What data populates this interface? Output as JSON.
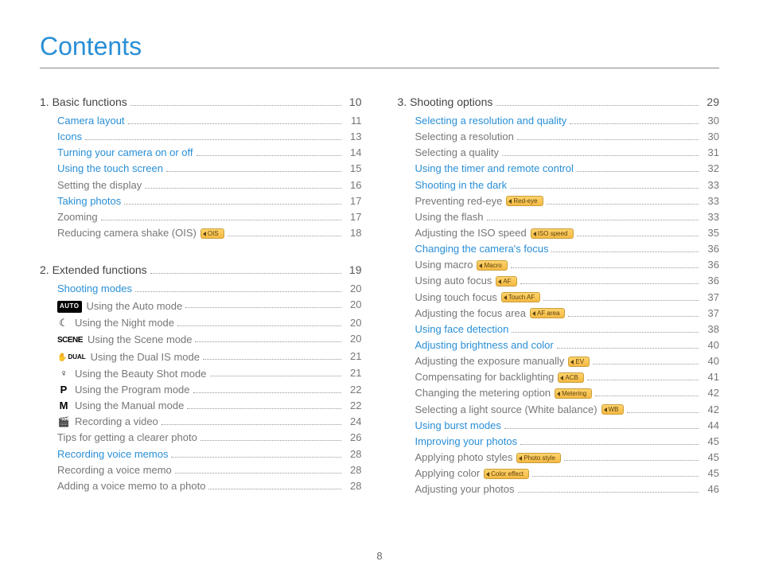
{
  "title": "Contents",
  "page_number": "8",
  "left": [
    {
      "type": "section",
      "label": "1. Basic functions",
      "page": "10"
    },
    {
      "type": "entry",
      "blue": true,
      "label": "Camera layout",
      "page": "11"
    },
    {
      "type": "entry",
      "blue": true,
      "label": "Icons",
      "page": "13"
    },
    {
      "type": "entry",
      "blue": true,
      "label": "Turning your camera on or off",
      "page": "14"
    },
    {
      "type": "entry",
      "blue": true,
      "label": "Using the touch screen",
      "page": "15"
    },
    {
      "type": "entry",
      "label": "Setting the display",
      "page": "16"
    },
    {
      "type": "entry",
      "blue": true,
      "label": "Taking photos",
      "page": "17"
    },
    {
      "type": "entry",
      "label": "Zooming",
      "page": "17"
    },
    {
      "type": "entry",
      "label": "Reducing camera shake (OIS)",
      "badge": "OIS",
      "page": "18"
    },
    {
      "type": "spacer"
    },
    {
      "type": "section",
      "label": "2. Extended functions",
      "page": "19"
    },
    {
      "type": "entry",
      "blue": true,
      "label": "Shooting modes",
      "page": "20"
    },
    {
      "type": "entry",
      "icon": "auto",
      "label": "Using the Auto mode",
      "page": "20"
    },
    {
      "type": "entry",
      "icon": "moon",
      "label": "Using the Night mode",
      "page": "20"
    },
    {
      "type": "entry",
      "icon": "scene",
      "label": "Using the Scene mode",
      "page": "20"
    },
    {
      "type": "entry",
      "icon": "dual",
      "label": "Using the Dual IS mode",
      "page": "21"
    },
    {
      "type": "entry",
      "icon": "beauty",
      "label": "Using the Beauty Shot mode",
      "page": "21"
    },
    {
      "type": "entry",
      "icon": "p",
      "label": "Using the Program mode",
      "page": "22"
    },
    {
      "type": "entry",
      "icon": "m",
      "label": "Using the Manual mode",
      "page": "22"
    },
    {
      "type": "entry",
      "icon": "video",
      "label": "Recording a video",
      "page": "24"
    },
    {
      "type": "entry",
      "label": "Tips for getting a clearer photo",
      "page": "26"
    },
    {
      "type": "entry",
      "blue": true,
      "label": "Recording voice memos",
      "page": "28"
    },
    {
      "type": "entry",
      "label": "Recording a voice memo",
      "page": "28"
    },
    {
      "type": "entry",
      "label": "Adding a voice memo to a photo",
      "page": "28"
    }
  ],
  "right": [
    {
      "type": "section",
      "label": "3. Shooting options",
      "page": "29"
    },
    {
      "type": "entry",
      "blue": true,
      "label": "Selecting a resolution and quality",
      "page": "30"
    },
    {
      "type": "entry",
      "label": "Selecting a resolution",
      "page": "30"
    },
    {
      "type": "entry",
      "label": "Selecting a quality",
      "page": "31"
    },
    {
      "type": "entry",
      "blue": true,
      "label": "Using the timer and remote control",
      "page": "32"
    },
    {
      "type": "entry",
      "blue": true,
      "label": "Shooting in the dark",
      "page": "33"
    },
    {
      "type": "entry",
      "label": "Preventing red-eye",
      "badge": "Red-eye",
      "page": "33"
    },
    {
      "type": "entry",
      "label": "Using the flash",
      "page": "33"
    },
    {
      "type": "entry",
      "label": "Adjusting the ISO speed",
      "badge": "ISO speed",
      "page": "35"
    },
    {
      "type": "entry",
      "blue": true,
      "label": "Changing the camera's focus",
      "page": "36"
    },
    {
      "type": "entry",
      "label": "Using macro",
      "badge": "Macro",
      "page": "36"
    },
    {
      "type": "entry",
      "label": "Using auto focus",
      "badge": "AF",
      "page": "36"
    },
    {
      "type": "entry",
      "label": "Using touch focus",
      "badge": "Touch AF",
      "page": "37"
    },
    {
      "type": "entry",
      "label": "Adjusting the focus area",
      "badge": "AF area",
      "page": "37"
    },
    {
      "type": "entry",
      "blue": true,
      "label": "Using face detection",
      "page": "38"
    },
    {
      "type": "entry",
      "blue": true,
      "label": "Adjusting brightness and color",
      "page": "40"
    },
    {
      "type": "entry",
      "label": "Adjusting the exposure manually",
      "badge": "EV",
      "page": "40"
    },
    {
      "type": "entry",
      "label": "Compensating for backlighting",
      "badge": "ACB",
      "page": "41"
    },
    {
      "type": "entry",
      "label": "Changing the metering option",
      "badge": "Metering",
      "page": "42"
    },
    {
      "type": "entry",
      "label": "Selecting a light source (White balance)",
      "badge": "WB",
      "page": "42"
    },
    {
      "type": "entry",
      "blue": true,
      "label": "Using burst modes",
      "page": "44"
    },
    {
      "type": "entry",
      "blue": true,
      "label": "Improving your photos",
      "page": "45"
    },
    {
      "type": "entry",
      "label": "Applying photo styles",
      "badge": "Photo style",
      "page": "45"
    },
    {
      "type": "entry",
      "label": "Applying color",
      "badge": "Color effect",
      "page": "45"
    },
    {
      "type": "entry",
      "label": "Adjusting your photos",
      "page": "46"
    }
  ]
}
